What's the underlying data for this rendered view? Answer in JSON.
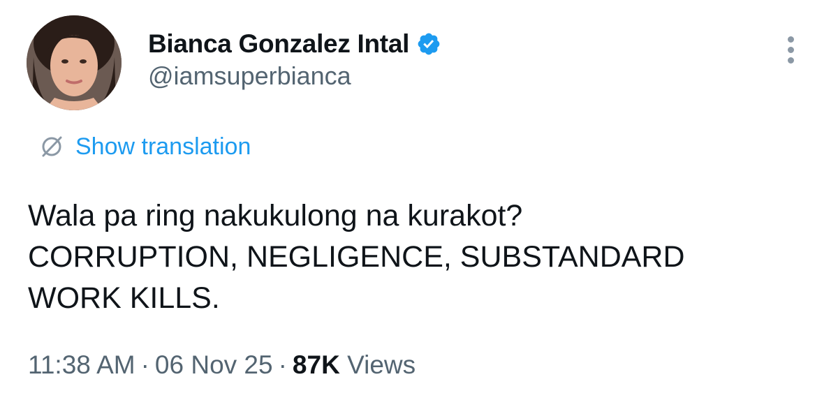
{
  "author": {
    "name": "Bianca Gonzalez Intal",
    "handle": "@iamsuperbianca",
    "verified": true,
    "avatar_icon": "profile-photo"
  },
  "translation": {
    "label": "Show translation",
    "icon": "translate-icon"
  },
  "tweet": {
    "lines": [
      "Wala pa ring nakukulong na kurakot?",
      "CORRUPTION, NEGLIGENCE, SUBSTANDARD",
      "WORK KILLS."
    ]
  },
  "meta": {
    "time": "11:38 AM",
    "separator": "·",
    "date": "06 Nov 25",
    "views_count": "87K",
    "views_label": "Views"
  },
  "colors": {
    "verified_badge": "#1d9bf0",
    "link": "#1d9bf0",
    "secondary_text": "#536471"
  }
}
